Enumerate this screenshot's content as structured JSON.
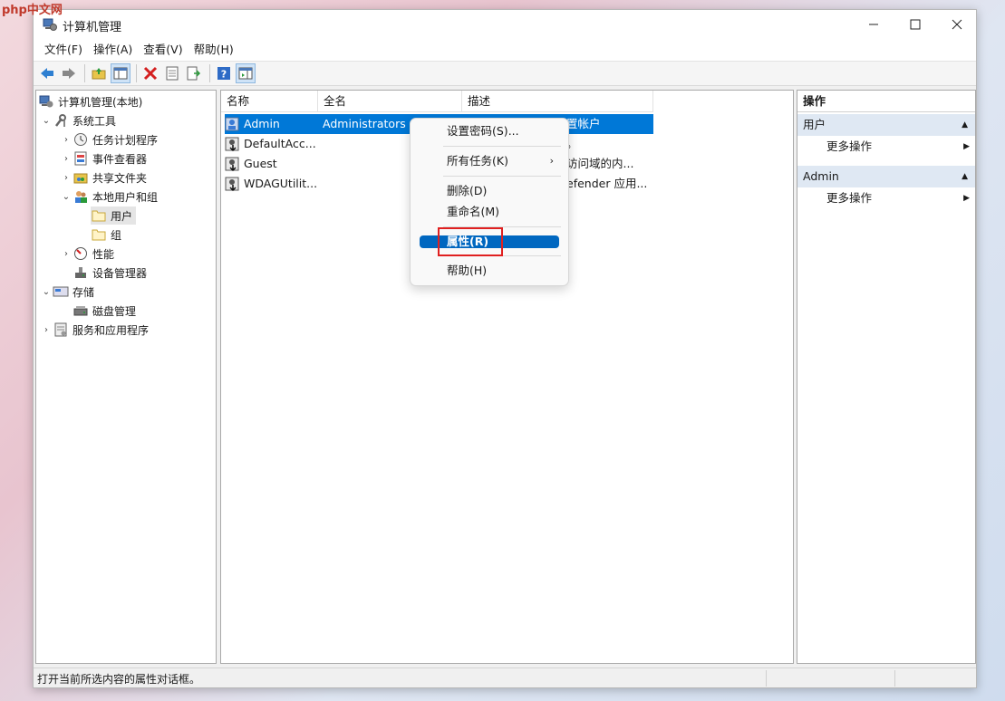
{
  "watermark": {
    "brand": "php",
    "site": "中文网"
  },
  "window": {
    "title": "计算机管理"
  },
  "menu": [
    "文件(F)",
    "操作(A)",
    "查看(V)",
    "帮助(H)"
  ],
  "toolbar": {
    "icons": [
      "back-arrow-icon",
      "forward-arrow-icon",
      "up-folder-icon",
      "show-hide-tree-icon",
      "delete-icon",
      "properties-icon",
      "export-icon",
      "help-icon",
      "show-hide-action-pane-icon"
    ]
  },
  "tree": {
    "root": "计算机管理(本地)",
    "system_tools": "系统工具",
    "task_scheduler": "任务计划程序",
    "event_viewer": "事件查看器",
    "shared_folders": "共享文件夹",
    "local_users": "本地用户和组",
    "users": "用户",
    "groups": "组",
    "performance": "性能",
    "device_manager": "设备管理器",
    "storage": "存储",
    "disk_management": "磁盘管理",
    "services": "服务和应用程序"
  },
  "list": {
    "columns": [
      "名称",
      "全名",
      "描述"
    ],
    "rows": [
      {
        "name": "Admin",
        "full": "Administrators",
        "desc": "置帐户"
      },
      {
        "name": "DefaultAcc...",
        "full": "",
        "desc": "。"
      },
      {
        "name": "Guest",
        "full": "",
        "desc": "访问域的内..."
      },
      {
        "name": "WDAGUtilit...",
        "full": "",
        "desc": "efender 应用..."
      }
    ]
  },
  "context_menu": {
    "set_password": "设置密码(S)...",
    "all_tasks": "所有任务(K)",
    "delete": "删除(D)",
    "rename": "重命名(M)",
    "properties": "属性(R)",
    "help": "帮助(H)"
  },
  "actions": {
    "title": "操作",
    "section1": "用户",
    "section1_more": "更多操作",
    "section2": "Admin",
    "section2_more": "更多操作"
  },
  "status": {
    "text": "打开当前所选内容的属性对话框。"
  },
  "colors": {
    "selection": "#0078d7",
    "highlight_box": "#e02020",
    "action_header": "#dfe8f3"
  }
}
